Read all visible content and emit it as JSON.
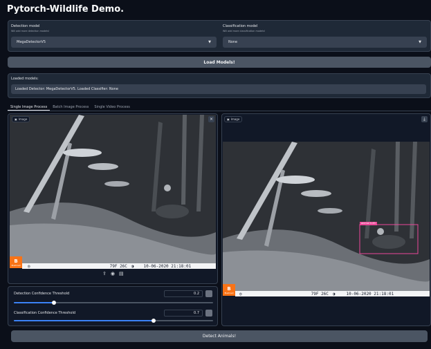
{
  "app": {
    "title": "Pytorch-Wildlife Demo."
  },
  "detection": {
    "label": "Detection model",
    "hint": "Will add more detection models!",
    "value": "MegaDetectorV5"
  },
  "classification": {
    "label": "Classification model",
    "hint": "Will add more classification models!",
    "value": "None"
  },
  "load_button": "Load Models!",
  "loaded": {
    "label": "Loaded models:",
    "text": "Loaded Detector: MegaDetectorV5. Loaded Classifier: None"
  },
  "tabs": [
    {
      "label": "Single Image Process"
    },
    {
      "label": "Batch Image Process"
    },
    {
      "label": "Single Video Process"
    }
  ],
  "input_image": {
    "chip": "Image",
    "brand": "Bushnell",
    "temp": "79F 26C",
    "datetime": "10-06-2020  21:18:01"
  },
  "output_image": {
    "chip": "Image",
    "brand": "Bushnell",
    "temp": "79F 26C",
    "datetime": "10-06-2020  21:18:01",
    "box_label": "animal 0.83"
  },
  "sliders": {
    "detection": {
      "label": "Detection Confidence Threshold",
      "value": "0.2",
      "fraction": 0.2
    },
    "classification": {
      "label": "Classification Confidence Threshold",
      "value": "0.7",
      "fraction": 0.7
    }
  },
  "detect_button": "Detect Animals!",
  "colors": {
    "accent": "#3b82f6",
    "bbox": "#ec4899",
    "brand": "#f97316"
  },
  "icons": [
    "image-icon",
    "close-icon",
    "download-icon",
    "upload-icon",
    "webcam-icon",
    "clipboard-icon",
    "caret-down-icon",
    "reset-icon"
  ]
}
